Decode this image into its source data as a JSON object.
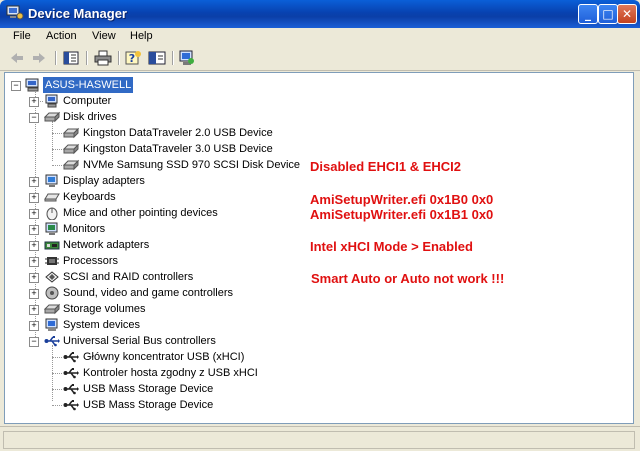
{
  "window": {
    "title": "Device Manager"
  },
  "menu": [
    "File",
    "Action",
    "View",
    "Help"
  ],
  "toolbar": {
    "icons": [
      "back-arrow-icon",
      "forward-arrow-icon",
      "properties-icon",
      "print-icon",
      "help-icon",
      "view-icon",
      "scan-hardware-icon"
    ]
  },
  "tree": {
    "root": "ASUS-HASWELL",
    "categories": [
      {
        "label": "Computer",
        "icon": "computer-icon"
      },
      {
        "label": "Disk drives",
        "icon": "disk-icon",
        "expanded": true,
        "children": [
          "Kingston DataTraveler 2.0 USB Device",
          "Kingston DataTraveler 3.0 USB Device",
          "NVMe Samsung SSD 970 SCSI Disk Device"
        ]
      },
      {
        "label": "Display adapters",
        "icon": "display-icon"
      },
      {
        "label": "Keyboards",
        "icon": "keyboard-icon"
      },
      {
        "label": "Mice and other pointing devices",
        "icon": "mouse-icon"
      },
      {
        "label": "Monitors",
        "icon": "monitor-icon"
      },
      {
        "label": "Network adapters",
        "icon": "network-icon"
      },
      {
        "label": "Processors",
        "icon": "processor-icon"
      },
      {
        "label": "SCSI and RAID controllers",
        "icon": "scsi-icon"
      },
      {
        "label": "Sound, video and game controllers",
        "icon": "sound-icon"
      },
      {
        "label": "Storage volumes",
        "icon": "storage-icon"
      },
      {
        "label": "System devices",
        "icon": "system-icon"
      },
      {
        "label": "Universal Serial Bus controllers",
        "icon": "usb-icon",
        "expanded": true,
        "children": [
          "Główny koncentrator USB (xHCI)",
          "Kontroler hosta zgodny z USB xHCI",
          "USB Mass Storage Device",
          "USB Mass Storage Device"
        ]
      }
    ]
  },
  "notes": [
    "Disabled EHCI1 & EHCI2",
    "AmiSetupWriter.efi 0x1B0 0x0",
    "AmiSetupWriter.efi 0x1B1 0x0",
    "Intel xHCI Mode > Enabled",
    "Smart Auto or Auto not work !!!"
  ],
  "colors": {
    "note": "#e01010",
    "selection": "#316ac5",
    "titlebar": "#0842b0"
  }
}
